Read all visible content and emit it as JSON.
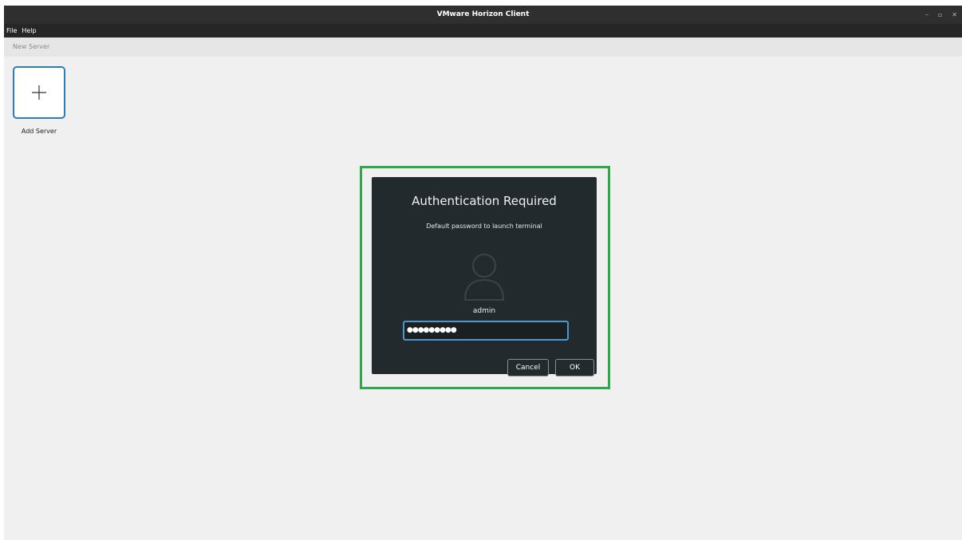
{
  "window": {
    "title": "VMware Horizon Client",
    "controls": {
      "minimize": "–",
      "maximize": "▫",
      "close": "✕"
    }
  },
  "menubar": {
    "items": [
      {
        "label": "File"
      },
      {
        "label": "Help"
      }
    ]
  },
  "toolbar": {
    "new_server_label": "New Server"
  },
  "servers": {
    "add_tile_icon": "plus-icon",
    "add_tile_label": "Add Server"
  },
  "auth_dialog": {
    "title": "Authentication Required",
    "subtitle": "Default password to launch terminal",
    "user_icon": "user-icon",
    "username": "admin",
    "password_value": "●●●●●●●●●",
    "cancel_label": "Cancel",
    "ok_label": "OK"
  },
  "colors": {
    "titlebar": "#2f2f2f",
    "menubar": "#262626",
    "background": "#f0f0f0",
    "dialog": "#222a2e",
    "accent_blue": "#2a7fb8",
    "focus_blue": "#4a98cf",
    "highlight_green": "#2ea84a"
  }
}
